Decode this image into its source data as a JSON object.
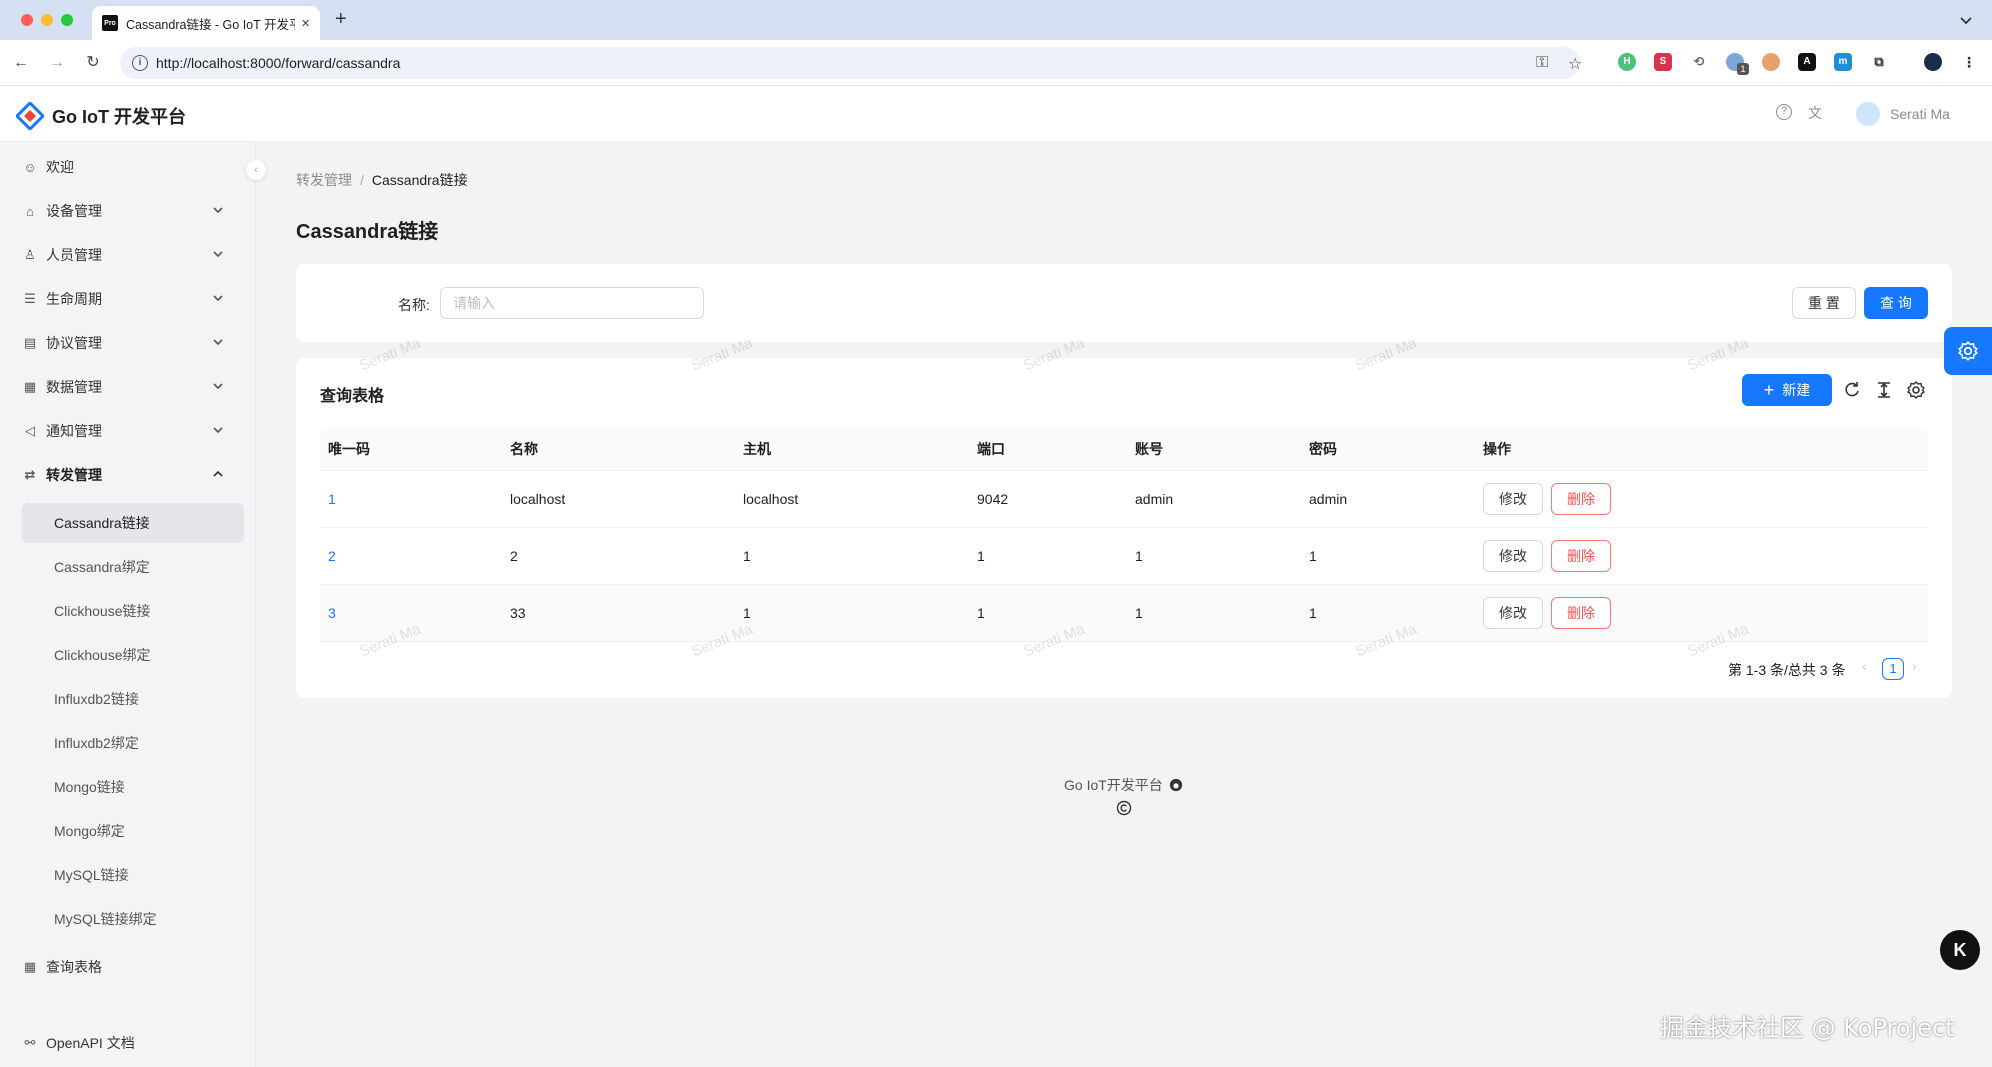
{
  "browser": {
    "tab_title": "Cassandra链接 - Go IoT 开发平",
    "tab_favicon": "Pro",
    "url": "http://localhost:8000/forward/cassandra",
    "extension_badge": "1"
  },
  "header": {
    "app_title": "Go IoT 开发平台",
    "user_name": "Serati Ma"
  },
  "sidebar": {
    "items": [
      {
        "label": "欢迎",
        "icon": "smile-icon"
      },
      {
        "label": "设备管理",
        "icon": "device-icon"
      },
      {
        "label": "人员管理",
        "icon": "user-icon"
      },
      {
        "label": "生命周期",
        "icon": "list-icon"
      },
      {
        "label": "协议管理",
        "icon": "protocol-icon"
      },
      {
        "label": "数据管理",
        "icon": "table-icon"
      },
      {
        "label": "通知管理",
        "icon": "notice-icon"
      },
      {
        "label": "转发管理",
        "icon": "forward-icon"
      }
    ],
    "sub_items": [
      "Cassandra链接",
      "Cassandra绑定",
      "Clickhouse链接",
      "Clickhouse绑定",
      "Influxdb2链接",
      "Influxdb2绑定",
      "Mongo链接",
      "Mongo绑定",
      "MySQL链接",
      "MySQL链接绑定"
    ],
    "bottom_items": [
      {
        "label": "查询表格",
        "icon": "table-icon"
      },
      {
        "label": "OpenAPI 文档",
        "icon": "link-icon"
      }
    ]
  },
  "breadcrumb": {
    "parent": "转发管理",
    "sep": "/",
    "current": "Cassandra链接"
  },
  "page_title": "Cassandra链接",
  "search": {
    "label": "名称:",
    "placeholder": "请输入",
    "reset_label": "重 置",
    "query_label": "查 询"
  },
  "table": {
    "title": "查询表格",
    "new_label": "新建",
    "columns": [
      "唯一码",
      "名称",
      "主机",
      "端口",
      "账号",
      "密码",
      "操作"
    ],
    "rows": [
      [
        "1",
        "localhost",
        "localhost",
        "9042",
        "admin",
        "admin"
      ],
      [
        "2",
        "2",
        "1",
        "1",
        "1",
        "1"
      ],
      [
        "3",
        "33",
        "1",
        "1",
        "1",
        "1"
      ]
    ],
    "edit_label": "修改",
    "delete_label": "删除",
    "pagination_summary": "第 1-3 条/总共 3 条",
    "current_page": "1"
  },
  "watermark_text": "Serati Ma",
  "footer": {
    "text": "Go IoT开发平台"
  },
  "float_k": "K",
  "site_watermark": "掘金技术社区 @ KoProject",
  "colors": {
    "primary": "#1677ff",
    "danger": "#ff4d4f"
  }
}
